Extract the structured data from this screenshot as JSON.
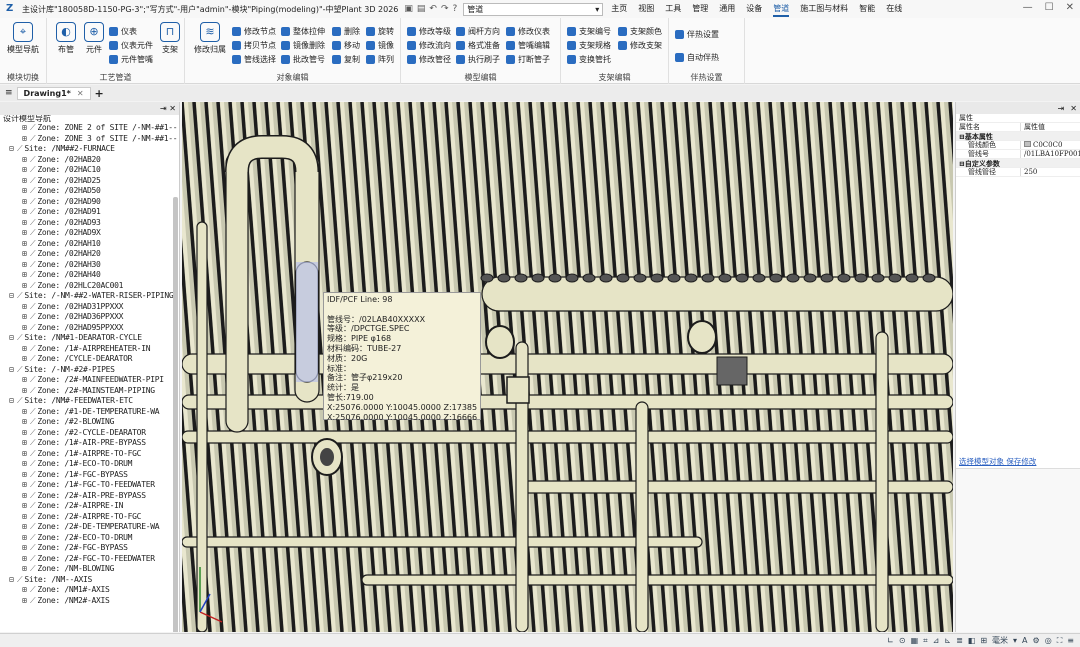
{
  "titlebar": {
    "title": "主设计库\"180058D-1150-PG-3\";\"写方式\"-用户\"admin\"-模块\"Piping(modeling)\"-中望Plant 3D 2026",
    "workspace": "管道",
    "tabs": [
      "主页",
      "视图",
      "工具",
      "管理",
      "通用",
      "设备",
      "管道",
      "施工图与材料",
      "智能",
      "在线"
    ],
    "active_tab": "管道"
  },
  "ribbon": {
    "groups": [
      {
        "label": "模块切换",
        "buttons": [
          "模型导航"
        ]
      },
      {
        "label": "工艺管道",
        "buttons": [
          "布管",
          "元件",
          "支架"
        ],
        "small": [
          "仪表",
          "仪表元件",
          "元件管嘴"
        ]
      },
      {
        "label": "对象编辑",
        "buttons": [
          "修改归属"
        ],
        "small": [
          "修改节点",
          "拷贝节点",
          "管线选择",
          "整体拉伸",
          "镜像删除",
          "批改管号",
          "删除",
          "移动",
          "复制",
          "旋转",
          "镜像",
          "阵列"
        ]
      },
      {
        "label": "模型编辑",
        "small": [
          "修改等级",
          "修改流向",
          "修改管径",
          "阀杆方向",
          "格式准备",
          "执行刷子",
          "修改仪表",
          "管嘴编辑",
          "打断管子"
        ]
      },
      {
        "label": "支架编辑",
        "small": [
          "支架编号",
          "支架规格",
          "变换管托",
          "支架颜色",
          "修改支架"
        ]
      },
      {
        "label": "伴热设置",
        "small": [
          "伴热设置",
          "自动伴热"
        ]
      }
    ]
  },
  "doc_tab": "Drawing1*",
  "left_panel": {
    "title": "设计模型导航",
    "tree": [
      {
        "kind": "zone",
        "label": "Zone: ZONE 2 of SITE /-NM-##1--"
      },
      {
        "kind": "zone",
        "label": "Zone: ZONE 3 of SITE /-NM-##1--"
      },
      {
        "kind": "site",
        "label": "Site: /NM##2-FURNACE"
      },
      {
        "kind": "zone",
        "label": "Zone: /02HAB20"
      },
      {
        "kind": "zone",
        "label": "Zone: /02HAC10"
      },
      {
        "kind": "zone",
        "label": "Zone: /02HAD25"
      },
      {
        "kind": "zone",
        "label": "Zone: /02HAD50"
      },
      {
        "kind": "zone",
        "label": "Zone: /02HAD90"
      },
      {
        "kind": "zone",
        "label": "Zone: /02HAD91"
      },
      {
        "kind": "zone",
        "label": "Zone: /02HAD93"
      },
      {
        "kind": "zone",
        "label": "Zone: /02HAD9X"
      },
      {
        "kind": "zone",
        "label": "Zone: /02HAH10"
      },
      {
        "kind": "zone",
        "label": "Zone: /02HAH20"
      },
      {
        "kind": "zone",
        "label": "Zone: /02HAH30"
      },
      {
        "kind": "zone",
        "label": "Zone: /02HAH40"
      },
      {
        "kind": "zone",
        "label": "Zone: /02HLC20AC001"
      },
      {
        "kind": "site",
        "label": "Site: /-NM-##2-WATER-RISER-PIPING"
      },
      {
        "kind": "zone",
        "label": "Zone: /02HAD31PPXXX"
      },
      {
        "kind": "zone",
        "label": "Zone: /02HAD36PPXXX"
      },
      {
        "kind": "zone",
        "label": "Zone: /02HAD95PPXXX"
      },
      {
        "kind": "site",
        "label": "Site: /NM#1-DEARATOR-CYCLE"
      },
      {
        "kind": "zone",
        "label": "Zone: /1#-AIRPREHEATER-IN"
      },
      {
        "kind": "zone",
        "label": "Zone: /CYCLE-DEARATOR"
      },
      {
        "kind": "site",
        "label": "Site: /-NM-#2#-PIPES"
      },
      {
        "kind": "zone",
        "label": "Zone: /2#-MAINFEEDWATER-PIPI"
      },
      {
        "kind": "zone",
        "label": "Zone: /2#-MAINSTEAM-PIPING"
      },
      {
        "kind": "site",
        "label": "Site: /NM#-FEEDWATER-ETC"
      },
      {
        "kind": "zone",
        "label": "Zone: /#1-DE-TEMPERATURE-WA"
      },
      {
        "kind": "zone",
        "label": "Zone: /#2-BLOWING"
      },
      {
        "kind": "zone",
        "label": "Zone: /#2-CYCLE-DEARATOR"
      },
      {
        "kind": "zone",
        "label": "Zone: /1#-AIR-PRE-BYPASS"
      },
      {
        "kind": "zone",
        "label": "Zone: /1#-AIRPRE-TO-FGC"
      },
      {
        "kind": "zone",
        "label": "Zone: /1#-ECO-TO-DRUM"
      },
      {
        "kind": "zone",
        "label": "Zone: /1#-FGC-BYPASS"
      },
      {
        "kind": "zone",
        "label": "Zone: /1#-FGC-TO-FEEDWATER"
      },
      {
        "kind": "zone",
        "label": "Zone: /2#-AIR-PRE-BYPASS"
      },
      {
        "kind": "zone",
        "label": "Zone: /2#-AIRPRE-IN"
      },
      {
        "kind": "zone",
        "label": "Zone: /2#-AIRPRE-TO-FGC"
      },
      {
        "kind": "zone",
        "label": "Zone: /2#-DE-TEMPERATURE-WA"
      },
      {
        "kind": "zone",
        "label": "Zone: /2#-ECO-TO-DRUM"
      },
      {
        "kind": "zone",
        "label": "Zone: /2#-FGC-BYPASS"
      },
      {
        "kind": "zone",
        "label": "Zone: /2#-FGC-TO-FEEDWATER"
      },
      {
        "kind": "zone",
        "label": "Zone: /NM-BLOWING"
      },
      {
        "kind": "site",
        "label": "Site: /NM--AXIS"
      },
      {
        "kind": "zone",
        "label": "Zone: /NM1#-AXIS"
      },
      {
        "kind": "zone",
        "label": "Zone: /NM2#-AXIS"
      }
    ]
  },
  "tooltip": {
    "lines": [
      "IDF/PCF Line: 98",
      "",
      "管线号：/02LAB40XXXXX",
      "等级：/DPCTGE.SPEC",
      "规格：PIPE φ168",
      "材料编码：TUBE-27",
      "材质：20G",
      "标准：",
      "备注：管子φ219x20",
      "统计：是",
      "管长:719.00",
      "X:25076.0000 Y:10045.0000 Z:17385.5000",
      "X:25076.0000 Y:10045.0000 Z:16666.5000"
    ]
  },
  "right_panel": {
    "title": "属性",
    "col_name": "属性名",
    "col_value": "属性值",
    "cat1": "基本属性",
    "rows1": [
      {
        "name": "管线颜色",
        "value": "C0C0C0"
      },
      {
        "name": "管线号",
        "value": "/01LBA10FP001"
      }
    ],
    "cat2": "自定义参数",
    "rows2": [
      {
        "name": "管线管径",
        "value": "250"
      }
    ],
    "link1": "选择模型对象",
    "link2": "保存修改"
  },
  "status": {
    "units": "毫米"
  },
  "colors": {
    "accent": "#1f5fa8",
    "viewport_bg": "#c8c8b0",
    "pipe": "#e6e4c6",
    "pipe_stroke": "#1c1c1c"
  }
}
